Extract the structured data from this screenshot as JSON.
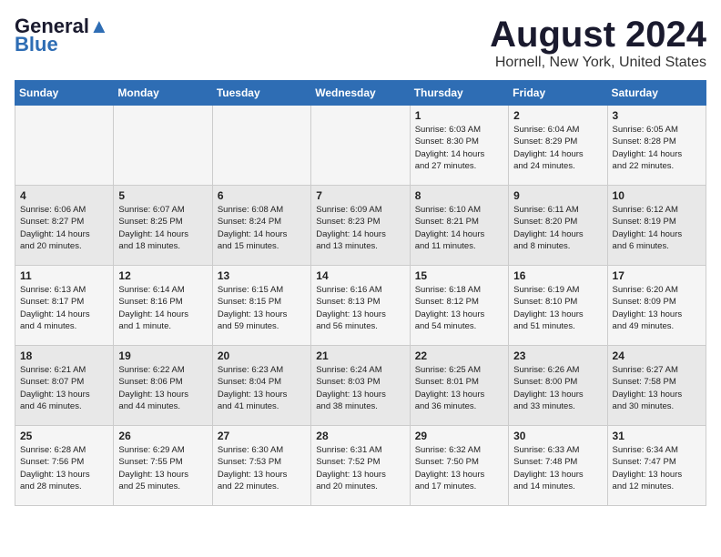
{
  "logo": {
    "part1": "General",
    "part2": "Blue"
  },
  "header": {
    "month": "August 2024",
    "location": "Hornell, New York, United States"
  },
  "days_of_week": [
    "Sunday",
    "Monday",
    "Tuesday",
    "Wednesday",
    "Thursday",
    "Friday",
    "Saturday"
  ],
  "weeks": [
    [
      {
        "day": "",
        "info": ""
      },
      {
        "day": "",
        "info": ""
      },
      {
        "day": "",
        "info": ""
      },
      {
        "day": "",
        "info": ""
      },
      {
        "day": "1",
        "info": "Sunrise: 6:03 AM\nSunset: 8:30 PM\nDaylight: 14 hours\nand 27 minutes."
      },
      {
        "day": "2",
        "info": "Sunrise: 6:04 AM\nSunset: 8:29 PM\nDaylight: 14 hours\nand 24 minutes."
      },
      {
        "day": "3",
        "info": "Sunrise: 6:05 AM\nSunset: 8:28 PM\nDaylight: 14 hours\nand 22 minutes."
      }
    ],
    [
      {
        "day": "4",
        "info": "Sunrise: 6:06 AM\nSunset: 8:27 PM\nDaylight: 14 hours\nand 20 minutes."
      },
      {
        "day": "5",
        "info": "Sunrise: 6:07 AM\nSunset: 8:25 PM\nDaylight: 14 hours\nand 18 minutes."
      },
      {
        "day": "6",
        "info": "Sunrise: 6:08 AM\nSunset: 8:24 PM\nDaylight: 14 hours\nand 15 minutes."
      },
      {
        "day": "7",
        "info": "Sunrise: 6:09 AM\nSunset: 8:23 PM\nDaylight: 14 hours\nand 13 minutes."
      },
      {
        "day": "8",
        "info": "Sunrise: 6:10 AM\nSunset: 8:21 PM\nDaylight: 14 hours\nand 11 minutes."
      },
      {
        "day": "9",
        "info": "Sunrise: 6:11 AM\nSunset: 8:20 PM\nDaylight: 14 hours\nand 8 minutes."
      },
      {
        "day": "10",
        "info": "Sunrise: 6:12 AM\nSunset: 8:19 PM\nDaylight: 14 hours\nand 6 minutes."
      }
    ],
    [
      {
        "day": "11",
        "info": "Sunrise: 6:13 AM\nSunset: 8:17 PM\nDaylight: 14 hours\nand 4 minutes."
      },
      {
        "day": "12",
        "info": "Sunrise: 6:14 AM\nSunset: 8:16 PM\nDaylight: 14 hours\nand 1 minute."
      },
      {
        "day": "13",
        "info": "Sunrise: 6:15 AM\nSunset: 8:15 PM\nDaylight: 13 hours\nand 59 minutes."
      },
      {
        "day": "14",
        "info": "Sunrise: 6:16 AM\nSunset: 8:13 PM\nDaylight: 13 hours\nand 56 minutes."
      },
      {
        "day": "15",
        "info": "Sunrise: 6:18 AM\nSunset: 8:12 PM\nDaylight: 13 hours\nand 54 minutes."
      },
      {
        "day": "16",
        "info": "Sunrise: 6:19 AM\nSunset: 8:10 PM\nDaylight: 13 hours\nand 51 minutes."
      },
      {
        "day": "17",
        "info": "Sunrise: 6:20 AM\nSunset: 8:09 PM\nDaylight: 13 hours\nand 49 minutes."
      }
    ],
    [
      {
        "day": "18",
        "info": "Sunrise: 6:21 AM\nSunset: 8:07 PM\nDaylight: 13 hours\nand 46 minutes."
      },
      {
        "day": "19",
        "info": "Sunrise: 6:22 AM\nSunset: 8:06 PM\nDaylight: 13 hours\nand 44 minutes."
      },
      {
        "day": "20",
        "info": "Sunrise: 6:23 AM\nSunset: 8:04 PM\nDaylight: 13 hours\nand 41 minutes."
      },
      {
        "day": "21",
        "info": "Sunrise: 6:24 AM\nSunset: 8:03 PM\nDaylight: 13 hours\nand 38 minutes."
      },
      {
        "day": "22",
        "info": "Sunrise: 6:25 AM\nSunset: 8:01 PM\nDaylight: 13 hours\nand 36 minutes."
      },
      {
        "day": "23",
        "info": "Sunrise: 6:26 AM\nSunset: 8:00 PM\nDaylight: 13 hours\nand 33 minutes."
      },
      {
        "day": "24",
        "info": "Sunrise: 6:27 AM\nSunset: 7:58 PM\nDaylight: 13 hours\nand 30 minutes."
      }
    ],
    [
      {
        "day": "25",
        "info": "Sunrise: 6:28 AM\nSunset: 7:56 PM\nDaylight: 13 hours\nand 28 minutes."
      },
      {
        "day": "26",
        "info": "Sunrise: 6:29 AM\nSunset: 7:55 PM\nDaylight: 13 hours\nand 25 minutes."
      },
      {
        "day": "27",
        "info": "Sunrise: 6:30 AM\nSunset: 7:53 PM\nDaylight: 13 hours\nand 22 minutes."
      },
      {
        "day": "28",
        "info": "Sunrise: 6:31 AM\nSunset: 7:52 PM\nDaylight: 13 hours\nand 20 minutes."
      },
      {
        "day": "29",
        "info": "Sunrise: 6:32 AM\nSunset: 7:50 PM\nDaylight: 13 hours\nand 17 minutes."
      },
      {
        "day": "30",
        "info": "Sunrise: 6:33 AM\nSunset: 7:48 PM\nDaylight: 13 hours\nand 14 minutes."
      },
      {
        "day": "31",
        "info": "Sunrise: 6:34 AM\nSunset: 7:47 PM\nDaylight: 13 hours\nand 12 minutes."
      }
    ]
  ]
}
